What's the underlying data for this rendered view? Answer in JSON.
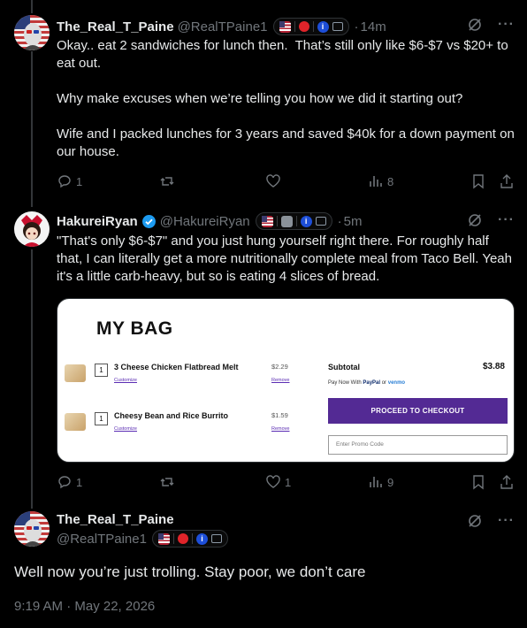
{
  "tweets": [
    {
      "name": "The_Real_T_Paine",
      "handle": "@RealTPaine1",
      "time": "14m",
      "body": "Okay.. eat 2 sandwiches for lunch then.  That’s still only like $6-$7 vs $20+ to eat out.\n\nWhy make excuses when we’re telling you how we did it starting out?\n\nWife and I packed lunches for 3 years and saved $40k for a down payment on our house.",
      "replies": "1",
      "retweets": "",
      "likes": "",
      "views": "8"
    },
    {
      "name": "HakureiRyan",
      "handle": "@HakureiRyan",
      "time": "5m",
      "body": "\"That's only $6-$7\" and you just hung yourself right there. For roughly half that, I can literally get a more nutritionally complete meal from Taco Bell. Yeah it's a little carb-heavy, but so is eating 4 slices of bread.",
      "replies": "1",
      "retweets": "",
      "likes": "1",
      "views": "9"
    }
  ],
  "media": {
    "title": "MY BAG",
    "items": [
      {
        "qty": "1",
        "name": "3 Cheese Chicken Flatbread Melt",
        "price": "$2.29",
        "customize": "Customize",
        "remove": "Remove"
      },
      {
        "qty": "1",
        "name": "Cheesy Bean and Rice Burrito",
        "price": "$1.59",
        "customize": "Customize",
        "remove": "Remove"
      }
    ],
    "subtotal_label": "Subtotal",
    "subtotal_value": "$3.88",
    "pay_prefix": "Pay Now With",
    "pay_paypal": "PayPal",
    "pay_or": "or",
    "pay_venmo": "venmo",
    "checkout_label": "PROCEED TO CHECKOUT",
    "promo_placeholder": "Enter Promo Code"
  },
  "main_tweet": {
    "name": "The_Real_T_Paine",
    "handle": "@RealTPaine1",
    "body": "Well now you’re just trolling.  Stay poor, we don’t care",
    "timestamp": "9:19 AM · May 22, 2026"
  },
  "icons": {
    "more": "···",
    "dot": "·"
  }
}
